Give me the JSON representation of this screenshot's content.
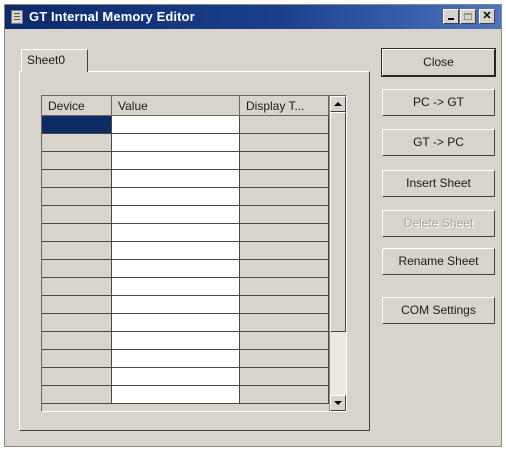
{
  "window": {
    "title": "GT Internal Memory Editor"
  },
  "tabs": [
    {
      "label": "Sheet0"
    }
  ],
  "grid": {
    "columns": [
      "Device",
      "Value",
      "Display T..."
    ],
    "row_count": 16,
    "selected_row": 0
  },
  "buttons": {
    "close": "Close",
    "pc_to_gt": "PC -> GT",
    "gt_to_pc": "GT -> PC",
    "insert_sheet": "Insert Sheet",
    "delete_sheet": "Delete Sheet",
    "rename_sheet": "Rename Sheet",
    "com_settings": "COM Settings"
  },
  "button_states": {
    "delete_sheet": "disabled"
  },
  "colors": {
    "title_bar": "#0a2a6b",
    "selection": "#0c2a63",
    "face": "#d8d4cc"
  }
}
